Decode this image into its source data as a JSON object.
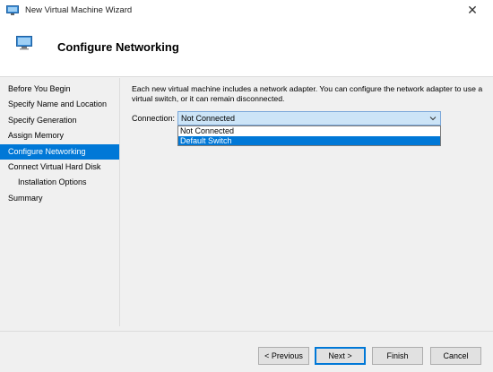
{
  "window": {
    "title": "New Virtual Machine Wizard",
    "close_glyph": "✕"
  },
  "header": {
    "title": "Configure Networking"
  },
  "sidebar": {
    "items": [
      {
        "label": "Before You Begin"
      },
      {
        "label": "Specify Name and Location"
      },
      {
        "label": "Specify Generation"
      },
      {
        "label": "Assign Memory"
      },
      {
        "label": "Configure Networking",
        "active": true
      },
      {
        "label": "Connect Virtual Hard Disk"
      },
      {
        "label": "Installation Options",
        "sub": true
      },
      {
        "label": "Summary"
      }
    ]
  },
  "main": {
    "description": "Each new virtual machine includes a network adapter. You can configure the network adapter to use a virtual switch, or it can remain disconnected.",
    "connection_label": "Connection:",
    "connection_value": "Not Connected",
    "options": [
      "Not Connected",
      "Default Switch"
    ]
  },
  "footer": {
    "previous_label": "< Previous",
    "next_label": "Next >",
    "finish_label": "Finish",
    "cancel_label": "Cancel"
  },
  "colors": {
    "accent": "#0078d7",
    "select_bg": "#cce4f7"
  }
}
